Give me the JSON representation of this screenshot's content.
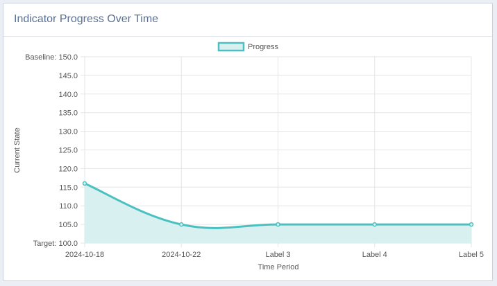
{
  "card": {
    "title": "Indicator Progress Over Time"
  },
  "chart_data": {
    "type": "area",
    "title": "",
    "xlabel": "Time Period",
    "ylabel": "Current State",
    "categories": [
      "2024-10-18",
      "2024-10-22",
      "Label 3",
      "Label 4",
      "Label 5"
    ],
    "series": [
      {
        "name": "Progress",
        "values": [
          116,
          105,
          105,
          105,
          105
        ]
      }
    ],
    "ylim": [
      100,
      150
    ],
    "y_ticks": [
      "Target: 100.0",
      "105.0",
      "110.0",
      "115.0",
      "120.0",
      "125.0",
      "130.0",
      "135.0",
      "140.0",
      "145.0",
      "Baseline: 150.0"
    ],
    "grid": true,
    "legend": "top-center",
    "colors": {
      "line": "#4bc0c0",
      "fill": "#d8f0f0",
      "grid": "#e5e5e5",
      "text": "#555555"
    }
  }
}
